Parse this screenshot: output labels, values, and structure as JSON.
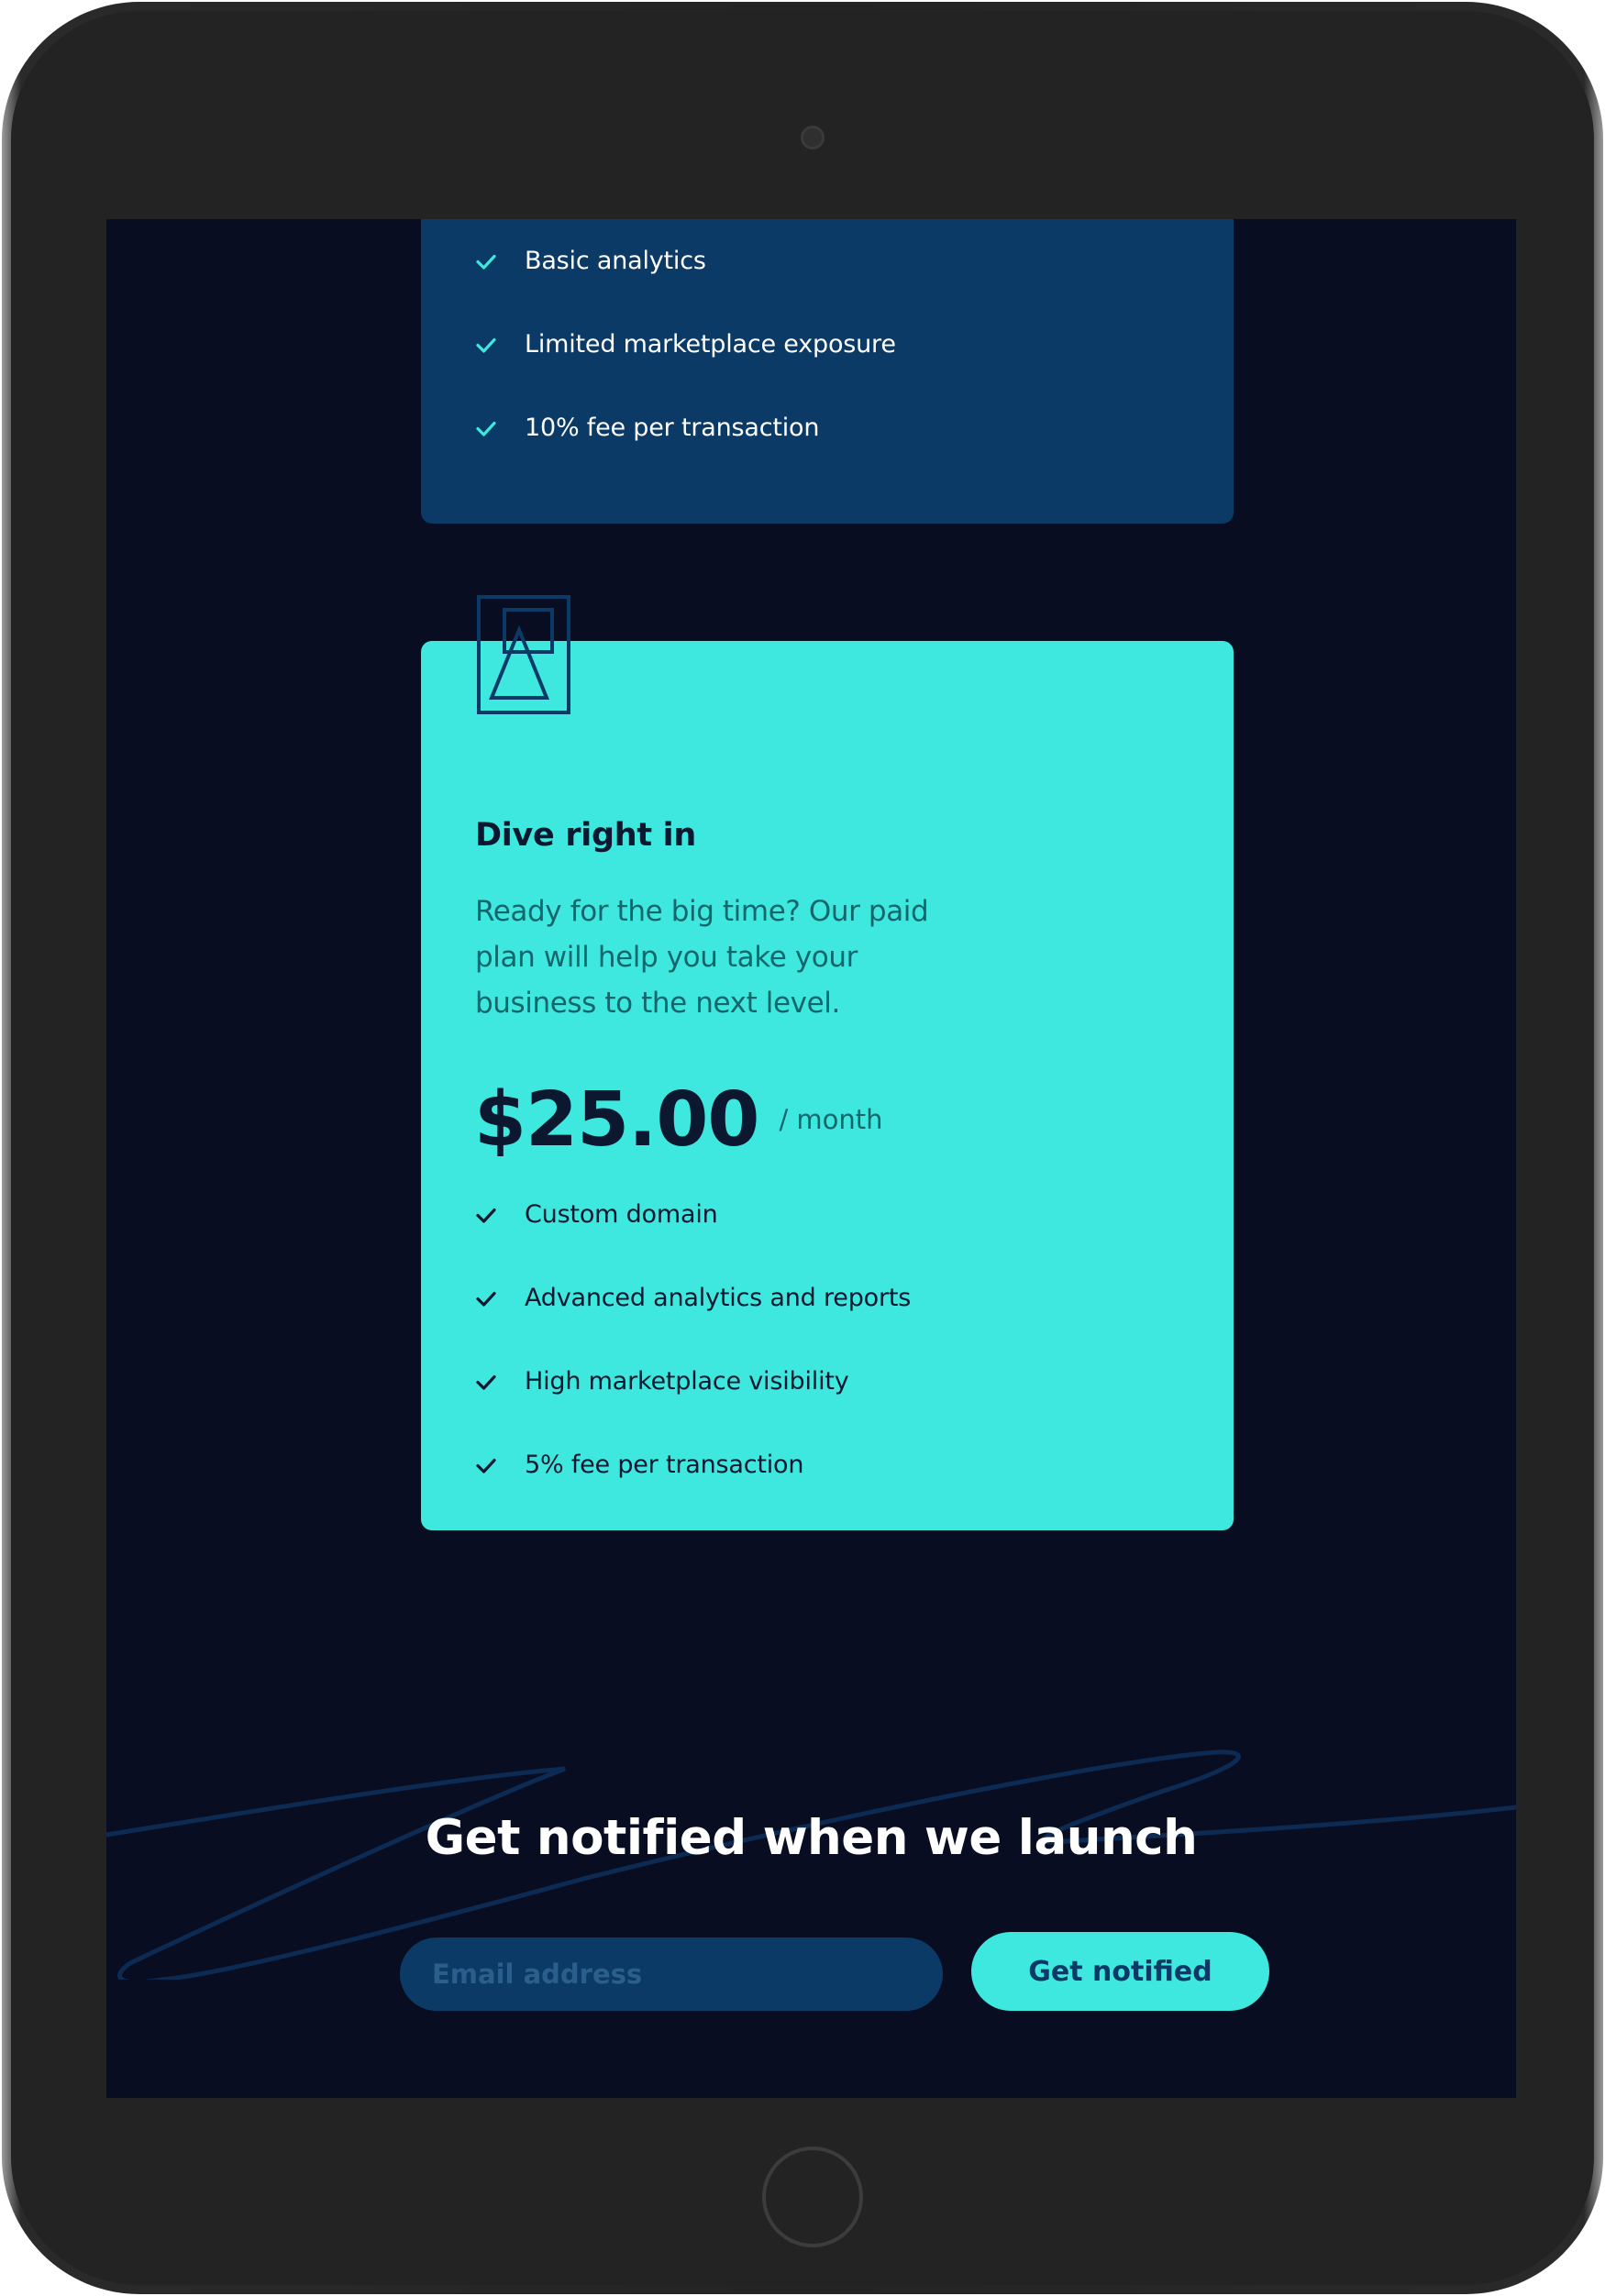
{
  "free_plan": {
    "features": [
      "Basic analytics",
      "Limited marketplace exposure",
      "10% fee per transaction"
    ]
  },
  "paid_plan": {
    "title": "Dive right in",
    "description": "Ready for the big time? Our paid plan will help you take your business to the next level.",
    "price": "$25.00",
    "period": "/ month",
    "features": [
      "Custom domain",
      "Advanced analytics and reports",
      "High marketplace visibility",
      "5% fee per transaction"
    ]
  },
  "notify": {
    "title": "Get notified when we launch",
    "email_placeholder": "Email address",
    "button_label": "Get notified"
  },
  "colors": {
    "screen_bg": "#080d21",
    "free_card_bg": "#0b3a66",
    "accent": "#3fe8de",
    "dark_text": "#0b1830"
  },
  "icons": {
    "check": "check-icon",
    "plan": "paid-plan-illustration-icon"
  }
}
